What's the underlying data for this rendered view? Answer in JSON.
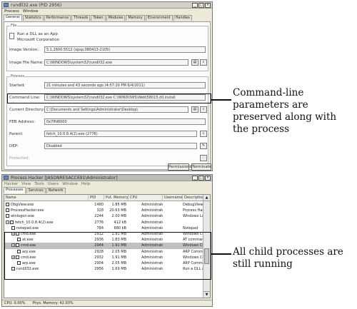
{
  "props_window": {
    "title": "rundll32.exe (PID 2956)",
    "menu": [
      "Process",
      "Window"
    ],
    "tabs": [
      "General",
      "Statistics",
      "Performance",
      "Threads",
      "Token",
      "Modules",
      "Memory",
      "Environment",
      "Handles"
    ],
    "active_tab": "General",
    "file_group": "File",
    "file_name": "Run a DLL as an App",
    "company": "Microsoft Corporation",
    "image_version_label": "Image Version:",
    "image_version": "5.1.2600.5512 (xpsp.080413-2105)",
    "image_file_label": "Image File Name:",
    "image_file": "C:\\WINDOWS\\system32\\rundll32.exe",
    "process_group": "Process",
    "started_label": "Started:",
    "started": "21 minutes and 43 seconds ago (4:57:20 PM 6/4/2011)",
    "cmdline_label": "Command Line:",
    "cmdline": "C:\\WINDOWS\\system32\\rundll32.exe C:\\WINDOWS\\Web\\58015.dll,install",
    "curdir_label": "Current Directory:",
    "curdir": "C:\\Documents and Settings\\Administrator\\Desktop\\",
    "peb_label": "PEB Address:",
    "peb": "0x7ffd6000",
    "parent_label": "Parent:",
    "parent": "fetch_10.0.8.4(2).exe (2776)",
    "dep_label": "DEP:",
    "dep": "Disabled",
    "protected_label": "Protected:",
    "permissions_button": "Permissions",
    "terminate_button": "Terminate"
  },
  "ph_window": {
    "title": "Process Hacker [JASONRESACC691\\Administrator]",
    "menu": [
      "Hacker",
      "View",
      "Tools",
      "Users",
      "Window",
      "Help"
    ],
    "tabs": [
      "Processes",
      "Services",
      "Network"
    ],
    "active_tab": "Processes",
    "columns": [
      "Name",
      "PID",
      "Pvt. Memory",
      "CPU",
      "Username",
      "Description"
    ],
    "rows": [
      {
        "name": "DbgView.exe",
        "pid": "1480",
        "mem": "1.85 MB",
        "cpu": "",
        "user": "Administrator",
        "desc": "DebugView",
        "depth": 1,
        "expander": "",
        "selected": false
      },
      {
        "name": "ProcessHacker.exe",
        "pid": "328",
        "mem": "20.63 MB",
        "cpu": "",
        "user": "Administrator",
        "desc": "Process Hacker",
        "depth": 1,
        "expander": "",
        "selected": false
      },
      {
        "name": "winlogon.exe",
        "pid": "2244",
        "mem": "2.00 MB",
        "cpu": "",
        "user": "Administrator",
        "desc": "Windows Logon",
        "depth": 1,
        "expander": "",
        "selected": false
      },
      {
        "name": "fetch_10.0.8.4(2).exe",
        "pid": "2776",
        "mem": "412 kB",
        "cpu": "",
        "user": "Administrator",
        "desc": "",
        "depth": 1,
        "expander": "−",
        "selected": false
      },
      {
        "name": "notepad.exe",
        "pid": "784",
        "mem": "680 kB",
        "cpu": "",
        "user": "Administrator",
        "desc": "Notepad",
        "depth": 2,
        "expander": "",
        "selected": false
      },
      {
        "name": "cmd.exe",
        "pid": "2912",
        "mem": "1.91 MB",
        "cpu": "",
        "user": "Administrator",
        "desc": "Windows Command",
        "depth": 2,
        "expander": "+",
        "selected": false
      },
      {
        "name": "at.exe",
        "pid": "2936",
        "mem": "1.83 MB",
        "cpu": "",
        "user": "Administrator",
        "desc": "AT command",
        "depth": 3,
        "expander": "",
        "selected": false
      },
      {
        "name": "cmd.exe",
        "pid": "2944",
        "mem": "1.91 MB",
        "cpu": "",
        "user": "Administrator",
        "desc": "Windows Command",
        "depth": 2,
        "expander": "+",
        "selected": true
      },
      {
        "name": "arp.exe",
        "pid": "2928",
        "mem": "2.05 MB",
        "cpu": "",
        "user": "Administrator",
        "desc": "ARP Comman",
        "depth": 3,
        "expander": "",
        "selected": false
      },
      {
        "name": "cmd.exe",
        "pid": "2932",
        "mem": "1.91 MB",
        "cpu": "",
        "user": "Administrator",
        "desc": "Windows Command",
        "depth": 2,
        "expander": "+",
        "selected": false
      },
      {
        "name": "arp.exe",
        "pid": "2904",
        "mem": "2.05 MB",
        "cpu": "",
        "user": "Administrator",
        "desc": "ARP Comman",
        "depth": 3,
        "expander": "",
        "selected": false
      },
      {
        "name": "rundll32.exe",
        "pid": "2956",
        "mem": "1.69 MB",
        "cpu": "",
        "user": "Administrator",
        "desc": "Run a DLL as",
        "depth": 2,
        "expander": "",
        "selected": false
      }
    ],
    "status": [
      "CPU: 0.00%",
      "Phys. Memory: 42.03%"
    ]
  },
  "annotations": {
    "cmdline_note": "Command-line parameters are preserved along with the process",
    "children_note": "All child processes are still running"
  }
}
